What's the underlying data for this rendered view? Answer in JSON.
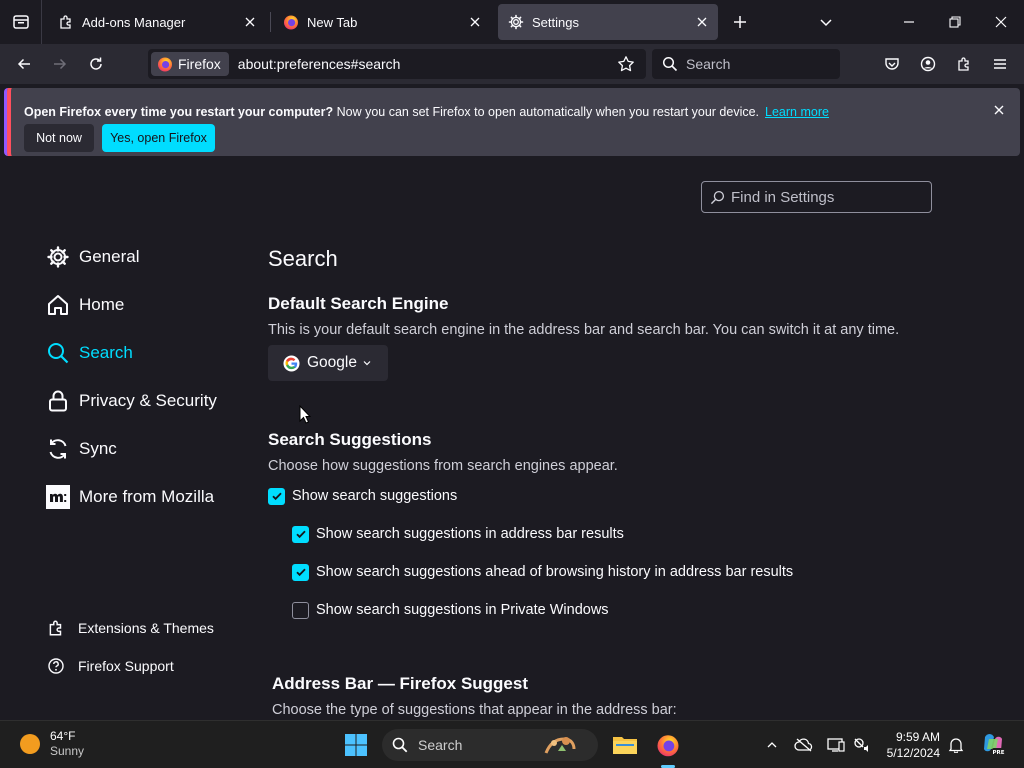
{
  "browser": {
    "tabs": [
      {
        "title": "Add-ons Manager",
        "icon": "puzzle-icon",
        "selected": false
      },
      {
        "title": "New Tab",
        "icon": "firefox-logo-icon",
        "selected": false
      },
      {
        "title": "Settings",
        "icon": "gear-icon",
        "selected": true
      }
    ],
    "identity_label": "Firefox",
    "url": "about:preferences#search",
    "search_placeholder": "Search"
  },
  "notification": {
    "bold_text": "Open Firefox every time you restart your computer?",
    "text": " Now you can set Firefox to open automatically when you restart your device.",
    "link": "Learn more",
    "secondary_button": "Not now",
    "primary_button": "Yes, open Firefox"
  },
  "settings": {
    "find_placeholder": "Find in Settings",
    "categories": [
      {
        "label": "General",
        "icon": "gear-icon"
      },
      {
        "label": "Home",
        "icon": "home-icon"
      },
      {
        "label": "Search",
        "icon": "search-icon",
        "selected": true
      },
      {
        "label": "Privacy & Security",
        "icon": "lock-icon"
      },
      {
        "label": "Sync",
        "icon": "sync-icon"
      },
      {
        "label": "More from Mozilla",
        "icon": "mozilla-icon"
      }
    ],
    "footer_links": [
      {
        "label": "Extensions & Themes",
        "icon": "puzzle-icon"
      },
      {
        "label": "Firefox Support",
        "icon": "help-icon"
      }
    ],
    "page_title": "Search",
    "default_engine": {
      "heading": "Default Search Engine",
      "description": "This is your default search engine in the address bar and search bar. You can switch it at any time.",
      "selected": "Google"
    },
    "suggestions": {
      "heading": "Search Suggestions",
      "description": "Choose how suggestions from search engines appear.",
      "options": [
        {
          "label": "Show search suggestions",
          "checked": true
        },
        {
          "label": "Show search suggestions in address bar results",
          "checked": true
        },
        {
          "label": "Show search suggestions ahead of browsing history in address bar results",
          "checked": true
        },
        {
          "label": "Show search suggestions in Private Windows",
          "checked": false
        }
      ]
    },
    "address_bar": {
      "heading": "Address Bar — Firefox Suggest",
      "description": "Choose the type of suggestions that appear in the address bar:"
    }
  },
  "taskbar": {
    "weather_temp": "64°F",
    "weather_condition": "Sunny",
    "search_placeholder": "Search",
    "time": "9:59 AM",
    "date": "5/12/2024"
  },
  "colors": {
    "accent": "#00ddff",
    "content_bg": "#1c1b22",
    "toolbar_bg": "#2b2a33"
  }
}
